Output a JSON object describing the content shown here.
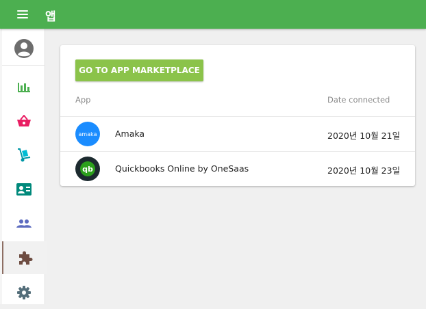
{
  "header": {
    "title": "앱",
    "menu_icon": "hamburger-menu-icon",
    "bg_color": "#4caf50"
  },
  "sidebar": {
    "items": [
      {
        "name": "profile",
        "icon": "user-circle-icon",
        "color": "#6d6d6d"
      },
      {
        "name": "reports",
        "icon": "bar-chart-icon",
        "color": "#4caf50"
      },
      {
        "name": "shop",
        "icon": "basket-icon",
        "color": "#e91e63"
      },
      {
        "name": "delivery",
        "icon": "hand-truck-icon",
        "color": "#00acc1"
      },
      {
        "name": "contacts",
        "icon": "contact-card-icon",
        "color": "#00897b"
      },
      {
        "name": "users",
        "icon": "people-icon",
        "color": "#5c6bc0"
      },
      {
        "name": "apps",
        "icon": "puzzle-icon",
        "color": "#6d4c41",
        "active": true
      },
      {
        "name": "settings",
        "icon": "gear-icon",
        "color": "#546e7a"
      }
    ]
  },
  "main": {
    "marketplace_button": "GO TO APP MARKETPLACE",
    "columns": {
      "app": "App",
      "date": "Date connected"
    },
    "apps": [
      {
        "name": "Amaka",
        "logo_text": "amaka",
        "logo_color": "#1a8cff",
        "date": "2020년 10월 21일"
      },
      {
        "name": "Quickbooks Online by OneSaas",
        "logo_text": "qb",
        "logo_color": "#1c2a2f",
        "date": "2020년 10월 23일"
      }
    ]
  }
}
